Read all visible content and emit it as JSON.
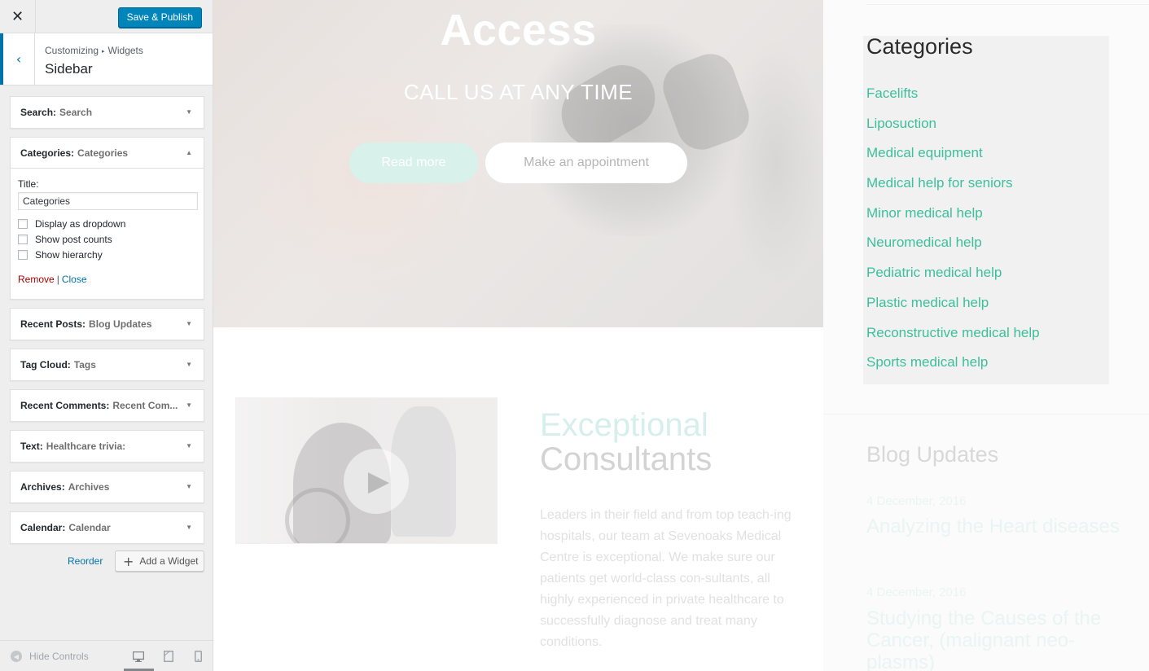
{
  "customizer": {
    "close_glyph": "✕",
    "publish_label": "Save & Publish",
    "back_glyph": "‹",
    "breadcrumb": {
      "root": "Customizing",
      "separator": "▸",
      "current": "Widgets"
    },
    "section_title": "Sidebar",
    "widgets": [
      {
        "type": "Search:",
        "title": "Search"
      },
      {
        "type": "Categories:",
        "title": "Categories",
        "expanded": true
      },
      {
        "type": "Recent Posts:",
        "title": "Blog Updates"
      },
      {
        "type": "Tag Cloud:",
        "title": "Tags"
      },
      {
        "type": "Recent Comments:",
        "title": "Recent Com..."
      },
      {
        "type": "Text:",
        "title": "Healthcare trivia:"
      },
      {
        "type": "Archives:",
        "title": "Archives"
      },
      {
        "type": "Calendar:",
        "title": "Calendar"
      }
    ],
    "categories_form": {
      "title_label": "Title:",
      "title_value": "Categories",
      "options": [
        {
          "label": "Display as dropdown",
          "checked": false
        },
        {
          "label": "Show post counts",
          "checked": false
        },
        {
          "label": "Show hierarchy",
          "checked": false
        }
      ],
      "remove_label": "Remove",
      "separator": "|",
      "close_label": "Close"
    },
    "arrow_down": "▼",
    "arrow_up": "▲",
    "reorder_label": "Reorder",
    "add_widget_glyph": "+",
    "add_widget_label": "Add a Widget",
    "hide_controls_label": "Hide Controls",
    "hide_glyph": "◀",
    "devices": {
      "desktop": "▭",
      "tablet": "▯",
      "mobile": "▯",
      "active": "desktop"
    }
  },
  "preview": {
    "hero": {
      "title": "Access",
      "subtitle": "CALL US AT ANY TIME",
      "read_more": "Read more",
      "appointment": "Make an appointment"
    },
    "video": {
      "play_glyph": "▶"
    },
    "feature": {
      "title_line1": "Exceptional",
      "title_line2": "Consultants",
      "body": "Leaders in their field and from top teach-ing hospitals, our team at Sevenoaks Medical Centre is exceptional. We make sure our patients get world-class con-sultants, all highly experienced in private healthcare to successfully diagnose and treat many conditions."
    },
    "sidebar": {
      "categories_title": "Categories",
      "categories": [
        "Facelifts",
        "Liposuction",
        "Medical equipment",
        "Medical help for seniors",
        "Minor medical help",
        "Neuromedical help",
        "Pediatric medical help",
        "Plastic medical help",
        "Reconstructive medical help",
        "Sports medical help"
      ],
      "blog_title": "Blog Updates",
      "posts": [
        {
          "date": "4 December, 2016",
          "title": "Analyzing the Heart diseases"
        },
        {
          "date": "4 December, 2016",
          "title": "Studying the Causes of the Cancer, (malignant neo-plasms)"
        }
      ]
    },
    "colors": {
      "accent": "#3cbf9a",
      "wp_blue": "#0073aa",
      "publish_blue": "#0085ba",
      "remove_red": "#aa0000"
    }
  }
}
